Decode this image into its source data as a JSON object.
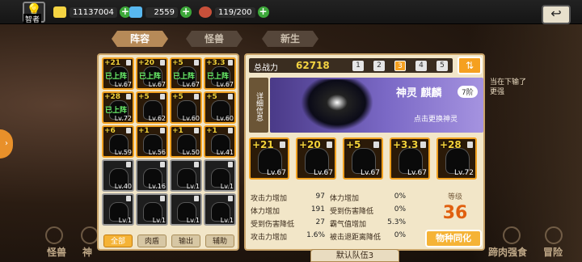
{
  "topbar": {
    "avatar_label": "智者",
    "gold": "11137004",
    "diamonds": "2559",
    "stamina": "119/200"
  },
  "tabs": [
    {
      "label": "阵容",
      "active": true
    },
    {
      "label": "怪兽",
      "active": false
    },
    {
      "label": "新生",
      "active": false
    }
  ],
  "grid": [
    {
      "stars": "+21",
      "status": "已上阵",
      "lv": "Lv.67"
    },
    {
      "stars": "+20",
      "status": "已上阵",
      "lv": "Lv.67"
    },
    {
      "stars": "+5",
      "status": "已上阵",
      "lv": "Lv.67"
    },
    {
      "stars": "+3.3",
      "status": "已上阵",
      "lv": "Lv.67"
    },
    {
      "stars": "+28",
      "status": "已上阵",
      "lv": "Lv.72"
    },
    {
      "stars": "+5",
      "status": "",
      "lv": "Lv.62"
    },
    {
      "stars": "+5",
      "status": "",
      "lv": "Lv.60"
    },
    {
      "stars": "+5",
      "status": "",
      "lv": "Lv.60"
    },
    {
      "stars": "+6",
      "status": "",
      "lv": "Lv.59"
    },
    {
      "stars": "+1",
      "status": "",
      "lv": "Lv.56"
    },
    {
      "stars": "+1",
      "status": "",
      "lv": "Lv.50"
    },
    {
      "stars": "+1",
      "status": "",
      "lv": "Lv.41"
    },
    {
      "stars": "",
      "status": "",
      "lv": "Lv.40"
    },
    {
      "stars": "",
      "status": "",
      "lv": "Lv.16"
    },
    {
      "stars": "",
      "status": "",
      "lv": "Lv.1"
    },
    {
      "stars": "",
      "status": "",
      "lv": "Lv.1"
    },
    {
      "stars": "",
      "status": "",
      "lv": "Lv.1"
    },
    {
      "stars": "",
      "status": "",
      "lv": "Lv.1"
    },
    {
      "stars": "",
      "status": "",
      "lv": "Lv.1"
    },
    {
      "stars": "",
      "status": "",
      "lv": "Lv.1"
    }
  ],
  "filters": [
    "全部",
    "肉盾",
    "输出",
    "辅助"
  ],
  "power": {
    "label": "总战力",
    "value": "62718"
  },
  "team_tabs": [
    "1",
    "2",
    "3",
    "4",
    "5"
  ],
  "detail_label": "详细信息",
  "god": {
    "name": "神灵 麒麟",
    "rank": "7阶",
    "hint": "点击更换神灵"
  },
  "party": [
    {
      "stars": "+21",
      "lv": "Lv.67"
    },
    {
      "stars": "+20",
      "lv": "Lv.67"
    },
    {
      "stars": "+5",
      "lv": "Lv.67"
    },
    {
      "stars": "+3.3",
      "lv": "Lv.67"
    },
    {
      "stars": "+28",
      "lv": "Lv.72"
    }
  ],
  "stats": [
    {
      "k1": "攻击力增加",
      "v1": "97",
      "k2": "体力增加",
      "v2": "0%"
    },
    {
      "k1": "体力增加",
      "v1": "191",
      "k2": "受到伤害降低",
      "v2": "0%"
    },
    {
      "k1": "受到伤害降低",
      "v1": "27",
      "k2": "霸气值增加",
      "v2": "5.3%"
    },
    {
      "k1": "攻击力增加",
      "v1": "1.6%",
      "k2": "被击退距离降低",
      "v2": "0%"
    }
  ],
  "level": {
    "label": "等级",
    "value": "36"
  },
  "sync_button": "物种同化",
  "team_label": "默认队伍3",
  "bottom_nav": [
    "怪兽",
    "神",
    "蹄肉强食",
    "冒险"
  ],
  "side_message": "当在下输了\n更强",
  "colors": {
    "accent": "#f5a020",
    "panel": "#f2e6c8",
    "god_banner": "#7b69c6"
  }
}
